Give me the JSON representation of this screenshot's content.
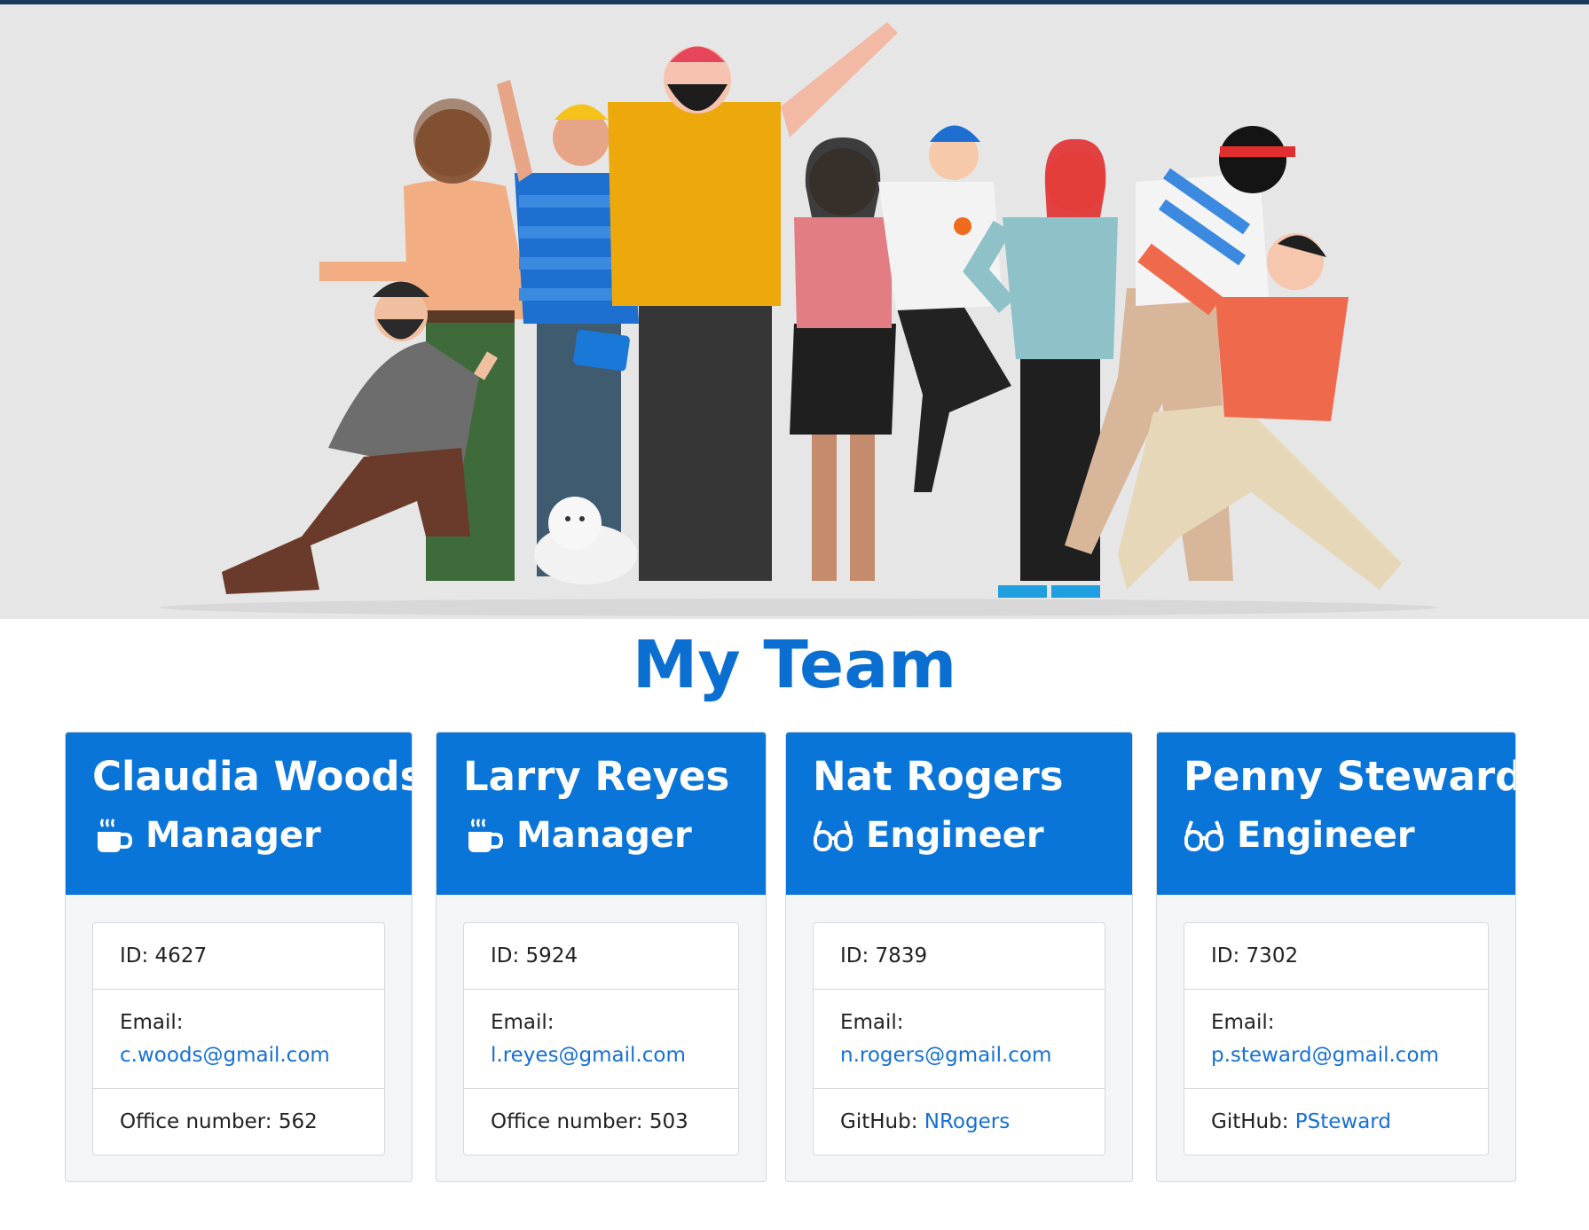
{
  "page": {
    "title": "My Team"
  },
  "colors": {
    "accent": "#0a75d8",
    "title": "#0a6fd1",
    "link": "#1670d4",
    "hero_bg": "#e6e6e6"
  },
  "hero": {
    "image": "team-illustration"
  },
  "team": [
    {
      "name": "Claudia Woods",
      "role": "Manager",
      "icon": "coffee-mug-icon",
      "id_label": "ID: 4627",
      "email_label": "Email:",
      "email": "c.woods@gmail.com",
      "extra_label": "Office number: 562",
      "extra_link": ""
    },
    {
      "name": "Larry Reyes",
      "role": "Manager",
      "icon": "coffee-mug-icon",
      "id_label": "ID: 5924",
      "email_label": "Email:",
      "email": "l.reyes@gmail.com",
      "extra_label": "Office number: 503",
      "extra_link": ""
    },
    {
      "name": "Nat Rogers",
      "role": "Engineer",
      "icon": "glasses-icon",
      "id_label": "ID: 7839",
      "email_label": "Email:",
      "email": "n.rogers@gmail.com",
      "extra_label": "GitHub: ",
      "extra_link": "NRogers"
    },
    {
      "name": "Penny Steward",
      "role": "Engineer",
      "icon": "glasses-icon",
      "id_label": "ID: 7302",
      "email_label": "Email:",
      "email": "p.steward@gmail.com",
      "extra_label": "GitHub: ",
      "extra_link": "PSteward"
    }
  ]
}
